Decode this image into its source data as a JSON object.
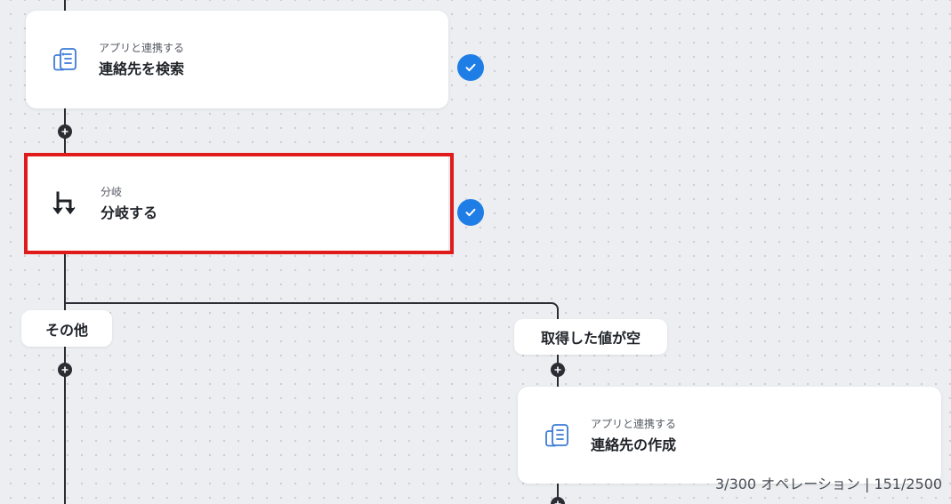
{
  "nodes": {
    "search_contacts": {
      "subtitle": "アプリと連携する",
      "title": "連絡先を検索",
      "icon": "app-document-icon"
    },
    "branch": {
      "subtitle": "分岐",
      "title": "分岐する",
      "icon": "branch-icon"
    },
    "create_contact": {
      "subtitle": "アプリと連携する",
      "title": "連絡先の作成",
      "icon": "app-document-icon"
    }
  },
  "branches": {
    "other": "その他",
    "empty": "取得した値が空"
  },
  "status": {
    "text": "3/300 オペレーション | 151/2500"
  },
  "colors": {
    "accent": "#1f7de6",
    "selection": "#e01b1b",
    "connector": "#2a2d33",
    "canvas": "#eceef1"
  }
}
